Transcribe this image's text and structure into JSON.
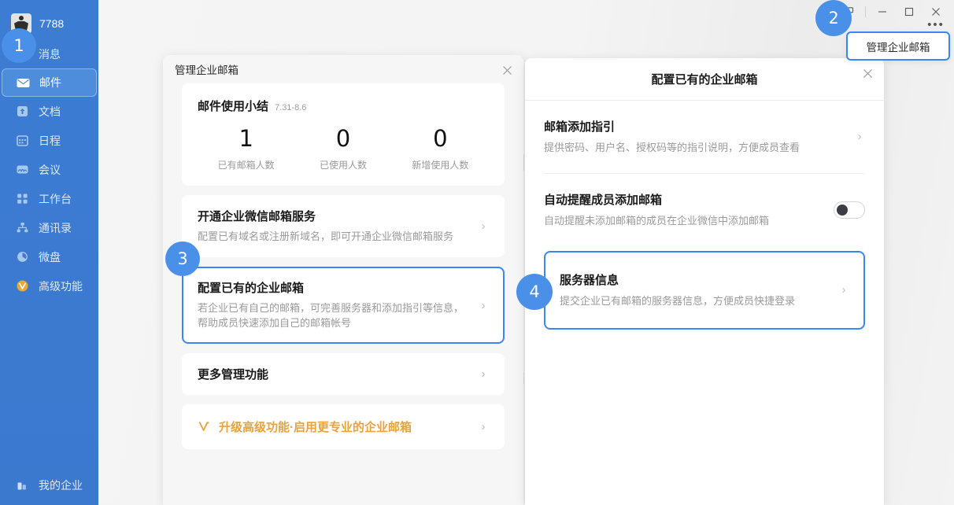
{
  "sidebar": {
    "user_name": "7788",
    "items": [
      {
        "label": "消息",
        "icon": "chat-icon",
        "active": false
      },
      {
        "label": "邮件",
        "icon": "mail-icon",
        "active": true
      },
      {
        "label": "文档",
        "icon": "doc-icon",
        "active": false
      },
      {
        "label": "日程",
        "icon": "calendar-icon",
        "active": false
      },
      {
        "label": "会议",
        "icon": "meeting-icon",
        "active": false
      },
      {
        "label": "工作台",
        "icon": "grid-icon",
        "active": false
      },
      {
        "label": "通讯录",
        "icon": "contacts-icon",
        "active": false
      },
      {
        "label": "微盘",
        "icon": "drive-icon",
        "active": false
      },
      {
        "label": "高级功能",
        "icon": "premium-icon",
        "active": false
      }
    ],
    "bottom_item": {
      "label": "我的企业",
      "icon": "company-icon"
    }
  },
  "window_controls": {
    "restore": "❐",
    "minimize": "—",
    "maximize": "▢",
    "close": "✕",
    "more": "•••"
  },
  "tooltip": {
    "text": "管理企业邮箱"
  },
  "badges": {
    "one": "1",
    "two": "2",
    "three": "3",
    "four": "4"
  },
  "left_dialog": {
    "title": "管理企业邮箱",
    "close_icon": "✕",
    "summary": {
      "title": "邮件使用小结",
      "date_range": "7.31-8.6",
      "stats": [
        {
          "value": "1",
          "label": "已有邮箱人数"
        },
        {
          "value": "0",
          "label": "已使用人数"
        },
        {
          "value": "0",
          "label": "新增使用人数"
        }
      ]
    },
    "actions": [
      {
        "title": "开通企业微信邮箱服务",
        "desc": "配置已有域名或注册新域名，即可开通企业微信邮箱服务",
        "selected": false
      },
      {
        "title": "配置已有的企业邮箱",
        "desc": "若企业已有自己的邮箱，可完善服务器和添加指引等信息，帮助成员快速添加自己的邮箱帐号",
        "selected": true
      }
    ],
    "more_row": {
      "title": "更多管理功能"
    },
    "upgrade_row": {
      "title": "升级高级功能·启用更专业的企业邮箱",
      "icon": "sparkle-icon"
    },
    "chevron": "›"
  },
  "right_dialog": {
    "title": "配置已有的企业邮箱",
    "close_icon": "✕",
    "items": [
      {
        "title": "邮箱添加指引",
        "desc": "提供密码、用户名、授权码等的指引说明，方便成员查看",
        "control": "chevron",
        "selected": false
      },
      {
        "title": "自动提醒成员添加邮箱",
        "desc": "自动提醒未添加邮箱的成员在企业微信中添加邮箱",
        "control": "toggle",
        "toggle_on": false,
        "selected": false
      },
      {
        "title": "服务器信息",
        "desc": "提交企业已有邮箱的服务器信息，方便成员快捷登录",
        "control": "chevron",
        "selected": true
      }
    ],
    "chevron": "›"
  },
  "colors": {
    "sidebar_blue": "#3c7cd4",
    "accent_blue": "#3a86f5",
    "badge_blue": "#4a90e8",
    "upgrade_orange": "#e8a33d",
    "page_bg": "#f4f4f4"
  }
}
